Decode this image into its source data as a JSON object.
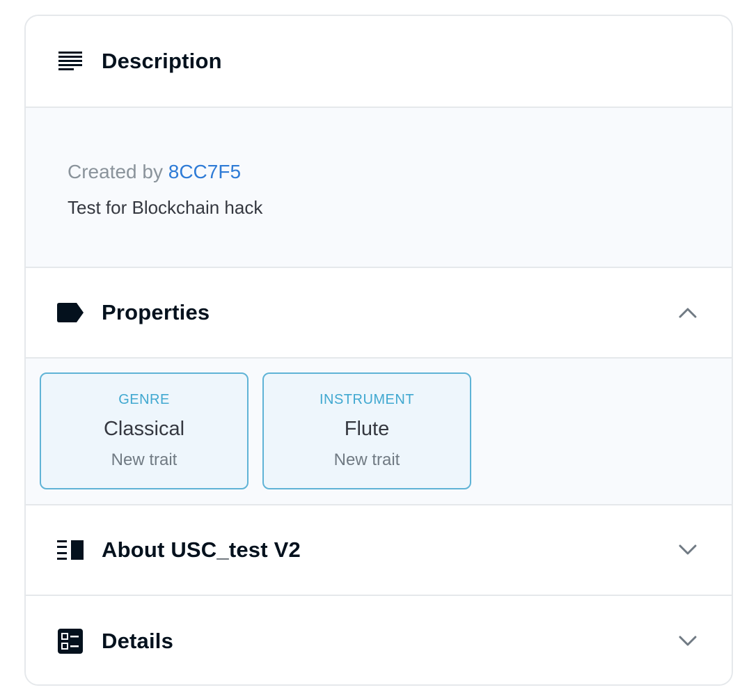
{
  "description": {
    "title": "Description",
    "created_by_label": "Created by",
    "creator": "8CC7F5",
    "text": "Test for Blockchain hack"
  },
  "properties": {
    "title": "Properties",
    "expanded": true,
    "traits": [
      {
        "type": "GENRE",
        "value": "Classical",
        "rarity": "New trait"
      },
      {
        "type": "INSTRUMENT",
        "value": "Flute",
        "rarity": "New trait"
      }
    ]
  },
  "about": {
    "title": "About USC_test V2",
    "expanded": false
  },
  "details": {
    "title": "Details",
    "expanded": false
  },
  "colors": {
    "text": "#04111d",
    "link": "#2e7bd6",
    "trait_border": "#5fb3d6",
    "trait_type": "#40a8d0",
    "panel_bg": "#f8fafd"
  },
  "icons": {
    "description": "subject-icon",
    "properties": "label-icon",
    "about": "vertical-split-icon",
    "details": "ballot-icon",
    "collapse": "chevron-up-icon",
    "expand": "chevron-down-icon"
  }
}
